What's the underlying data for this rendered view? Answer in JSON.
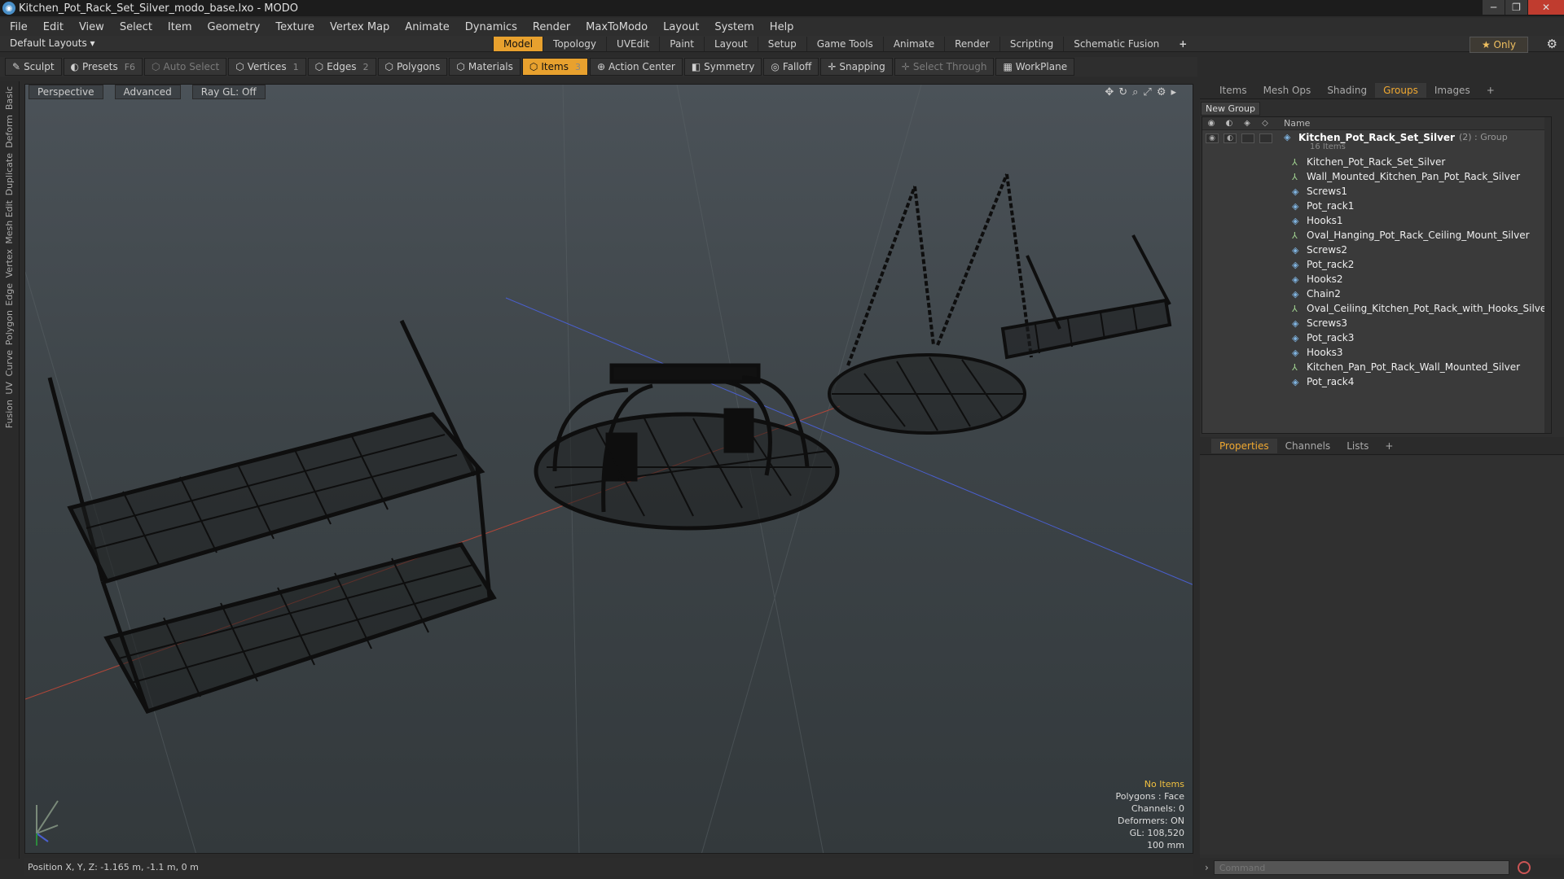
{
  "app": {
    "title": "Kitchen_Pot_Rack_Set_Silver_modo_base.lxo - MODO",
    "logo": "modo-logo-icon"
  },
  "window_buttons": {
    "min": "─",
    "max": "❐",
    "close": "✕"
  },
  "menu": [
    "File",
    "Edit",
    "View",
    "Select",
    "Item",
    "Geometry",
    "Texture",
    "Vertex Map",
    "Animate",
    "Dynamics",
    "Render",
    "MaxToModo",
    "Layout",
    "System",
    "Help"
  ],
  "layout_bar": {
    "layouts": "Default Layouts ▾",
    "tabs": [
      "Model",
      "Topology",
      "UVEdit",
      "Paint",
      "Layout",
      "Setup",
      "Game Tools",
      "Animate",
      "Render",
      "Scripting",
      "Schematic Fusion"
    ],
    "active_tab": "Model",
    "plus": "+",
    "only": "★  Only"
  },
  "toolbar": {
    "sculpt": "Sculpt",
    "presets": "Presets",
    "presets_key": "F6",
    "auto_select": "Auto Select",
    "vertices": "Vertices",
    "vertices_count": "1",
    "edges": "Edges",
    "edges_count": "2",
    "polygons": "Polygons",
    "materials": "Materials",
    "items": "Items",
    "items_count": "3",
    "action_center": "Action Center",
    "symmetry": "Symmetry",
    "falloff": "Falloff",
    "snapping": "Snapping",
    "select_through": "Select Through",
    "workplane": "WorkPlane"
  },
  "left_tabs": [
    "Basic",
    "Deform",
    "Duplicate",
    "Mesh Edit",
    "Vertex",
    "Edge",
    "Polygon",
    "Curve",
    "UV",
    "Fusion"
  ],
  "viewport": {
    "view": "Perspective",
    "shading": "Advanced",
    "raygl": "Ray GL: Off",
    "info": {
      "selection": "No Items",
      "polygons": "Polygons : Face",
      "channels": "Channels: 0",
      "deformers": "Deformers: ON",
      "gl": "GL: 108,520",
      "scale": "100 mm"
    }
  },
  "status": {
    "position": "Position X, Y, Z:  -1.165 m, -1.1 m, 0 m"
  },
  "panel_tabs": [
    "Items",
    "Mesh Ops",
    "Shading",
    "Groups",
    "Images",
    "+"
  ],
  "panel_active": "Groups",
  "groups": {
    "new_group": "New Group",
    "col_name": "Name",
    "group_name": "Kitchen_Pot_Rack_Set_Silver",
    "group_suffix": "(2) : Group",
    "group_count": "16 Items",
    "items": [
      {
        "name": "Kitchen_Pot_Rack_Set_Silver",
        "icon": "locator-icon"
      },
      {
        "name": "Wall_Mounted_Kitchen_Pan_Pot_Rack_Silver",
        "icon": "locator-icon"
      },
      {
        "name": "Screws1",
        "icon": "mesh-icon"
      },
      {
        "name": "Pot_rack1",
        "icon": "mesh-icon"
      },
      {
        "name": "Hooks1",
        "icon": "mesh-icon"
      },
      {
        "name": "Oval_Hanging_Pot_Rack_Ceiling_Mount_Silver",
        "icon": "locator-icon"
      },
      {
        "name": "Screws2",
        "icon": "mesh-icon"
      },
      {
        "name": "Pot_rack2",
        "icon": "mesh-icon"
      },
      {
        "name": "Hooks2",
        "icon": "mesh-icon"
      },
      {
        "name": "Chain2",
        "icon": "mesh-icon"
      },
      {
        "name": "Oval_Ceiling_Kitchen_Pot_Rack_with_Hooks_Silver",
        "icon": "locator-icon"
      },
      {
        "name": "Screws3",
        "icon": "mesh-icon"
      },
      {
        "name": "Pot_rack3",
        "icon": "mesh-icon"
      },
      {
        "name": "Hooks3",
        "icon": "mesh-icon"
      },
      {
        "name": "Kitchen_Pan_Pot_Rack_Wall_Mounted_Silver",
        "icon": "locator-icon"
      },
      {
        "name": "Pot_rack4",
        "icon": "mesh-icon"
      }
    ]
  },
  "lower_tabs": [
    "Properties",
    "Channels",
    "Lists",
    "+"
  ],
  "lower_active": "Properties",
  "command": {
    "placeholder": "Command"
  },
  "colors": {
    "accent": "#e8a12e",
    "close": "#c03c2f",
    "axis_x": "#c0483a",
    "axis_z": "#4a5fcf"
  }
}
